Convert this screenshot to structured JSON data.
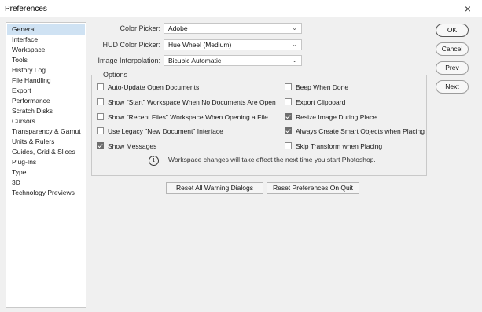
{
  "window": {
    "title": "Preferences",
    "close_glyph": "×"
  },
  "sidebar": {
    "items": [
      {
        "label": "General",
        "selected": true
      },
      {
        "label": "Interface"
      },
      {
        "label": "Workspace"
      },
      {
        "label": "Tools"
      },
      {
        "label": "History Log"
      },
      {
        "label": "File Handling"
      },
      {
        "label": "Export"
      },
      {
        "label": "Performance"
      },
      {
        "label": "Scratch Disks"
      },
      {
        "label": "Cursors"
      },
      {
        "label": "Transparency & Gamut"
      },
      {
        "label": "Units & Rulers"
      },
      {
        "label": "Guides, Grid & Slices"
      },
      {
        "label": "Plug-Ins"
      },
      {
        "label": "Type"
      },
      {
        "label": "3D"
      },
      {
        "label": "Technology Previews"
      }
    ]
  },
  "fields": {
    "color_picker": {
      "label": "Color Picker:",
      "value": "Adobe"
    },
    "hud_color_picker": {
      "label": "HUD Color Picker:",
      "value": "Hue Wheel (Medium)"
    },
    "image_interpolation": {
      "label": "Image Interpolation:",
      "value": "Bicubic Automatic"
    }
  },
  "options": {
    "legend": "Options",
    "left": [
      {
        "label": "Auto-Update Open Documents",
        "checked": false
      },
      {
        "label": "Show \"Start\" Workspace When No Documents Are Open",
        "checked": false
      },
      {
        "label": "Show \"Recent Files\" Workspace When Opening a File",
        "checked": false
      },
      {
        "label": "Use Legacy \"New Document\" Interface",
        "checked": false
      },
      {
        "label": "Show Messages",
        "checked": true
      }
    ],
    "right": [
      {
        "label": "Beep When Done",
        "checked": false
      },
      {
        "label": "Export Clipboard",
        "checked": false
      },
      {
        "label": "Resize Image During Place",
        "checked": true
      },
      {
        "label": "Always Create Smart Objects when Placing",
        "checked": true
      },
      {
        "label": "Skip Transform when Placing",
        "checked": false
      }
    ],
    "info_glyph": "i",
    "info_text": "Workspace changes will take effect the next time you start Photoshop."
  },
  "buttons": {
    "reset_warnings": "Reset All Warning Dialogs",
    "reset_prefs": "Reset Preferences On Quit",
    "ok": "OK",
    "cancel": "Cancel",
    "prev": "Prev",
    "next": "Next"
  },
  "icons": {
    "dropdown": "chevron-down-icon",
    "info": "info-icon",
    "close": "close-icon"
  }
}
